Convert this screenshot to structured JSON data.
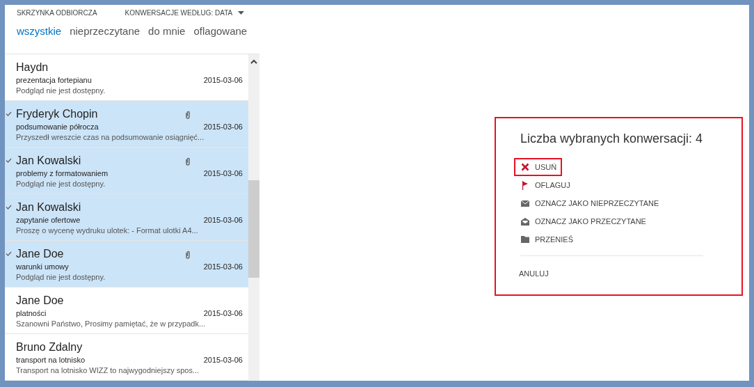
{
  "header": {
    "folder": "SKRZYNKA ODBIORCZA",
    "sort": "KONWERSACJE WEDŁUG: DATA"
  },
  "filters": [
    {
      "label": "wszystkie",
      "selected": true
    },
    {
      "label": "nieprzeczytane",
      "selected": false
    },
    {
      "label": "do mnie",
      "selected": false
    },
    {
      "label": "oflagowane",
      "selected": false
    }
  ],
  "messages": [
    {
      "sender": "Haydn",
      "subject": "prezentacja fortepianu",
      "date": "2015-03-06",
      "preview": "Podgląd nie jest dostępny.",
      "selected": false,
      "attachment": false
    },
    {
      "sender": "Fryderyk Chopin",
      "subject": "podsumowanie półrocza",
      "date": "2015-03-06",
      "preview": "Przyszedł wreszcie czas na podsumowanie osiągnięć...",
      "selected": true,
      "attachment": true
    },
    {
      "sender": "Jan Kowalski",
      "subject": "problemy z formatowaniem",
      "date": "2015-03-06",
      "preview": "Podgląd nie jest dostępny.",
      "selected": true,
      "attachment": true
    },
    {
      "sender": "Jan Kowalski",
      "subject": "zapytanie ofertowe",
      "date": "2015-03-06",
      "preview": "Proszę o wycenę wydruku ulotek: - Format ulotki A4...",
      "selected": true,
      "attachment": false
    },
    {
      "sender": "Jane Doe",
      "subject": "warunki umowy",
      "date": "2015-03-06",
      "preview": "Podgląd nie jest dostępny.",
      "selected": true,
      "attachment": true
    },
    {
      "sender": "Jane Doe",
      "subject": "platności",
      "date": "2015-03-06",
      "preview": "Szanowni Państwo, Prosimy pamiętać, że w przypadk...",
      "selected": false,
      "attachment": false
    },
    {
      "sender": "Bruno Zdalny",
      "subject": "transport na lotnisko",
      "date": "2015-03-06",
      "preview": "Transport na lotnisko WIZZ to najwygodniejszy spos...",
      "selected": false,
      "attachment": false
    }
  ],
  "selection_panel": {
    "highlighted": true,
    "title": "Liczba wybranych konwersacji: 4",
    "actions": [
      {
        "kind": "delete",
        "label": "USUŃ",
        "highlighted": true
      },
      {
        "kind": "flag",
        "label": "OFLAGUJ",
        "highlighted": false
      },
      {
        "kind": "unread",
        "label": "OZNACZ JAKO NIEPRZECZYTANE",
        "highlighted": false
      },
      {
        "kind": "read",
        "label": "OZNACZ JAKO PRZECZYTANE",
        "highlighted": false
      },
      {
        "kind": "move",
        "label": "PRZENIEŚ",
        "highlighted": false
      }
    ],
    "cancel": "ANULUJ"
  }
}
